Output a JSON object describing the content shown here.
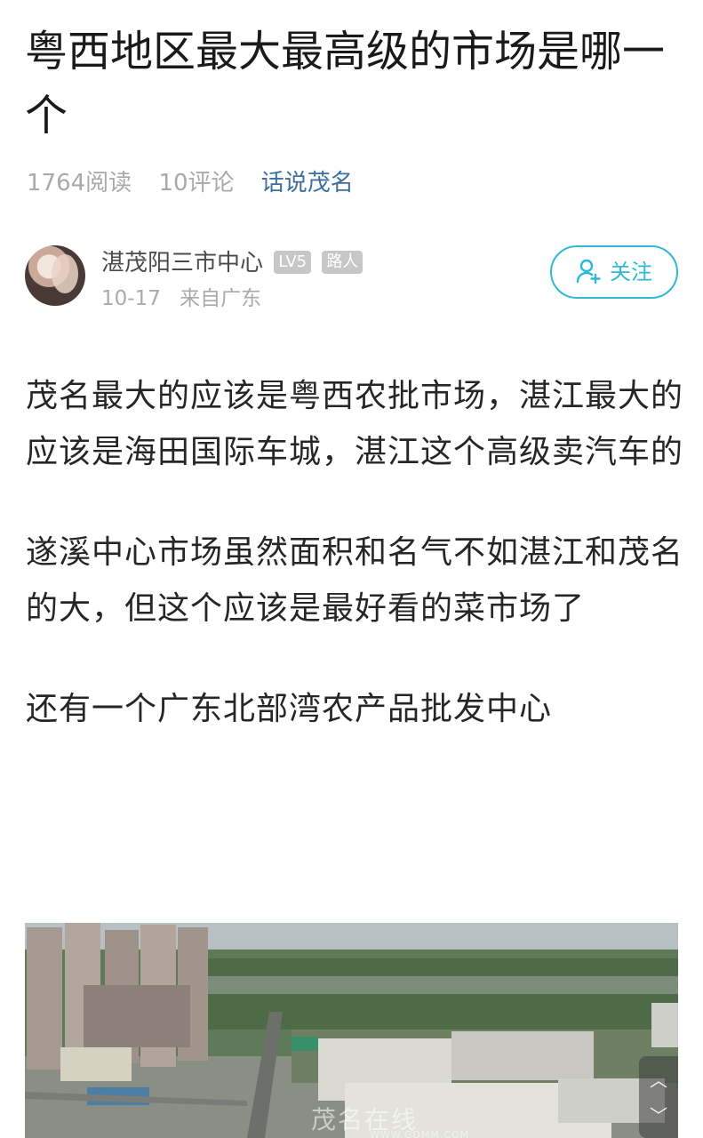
{
  "post": {
    "title": "粤西地区最大最高级的市场是哪一个",
    "reads": "1764阅读",
    "comments": "10评论",
    "topic": "话说茂名"
  },
  "author": {
    "name": "湛茂阳三市中心",
    "level_badge": "LV5",
    "role_badge": "路人",
    "date": "10-17",
    "location": "来自广东",
    "follow_label": "关注",
    "follow_icon": "user-plus-icon"
  },
  "article": {
    "paragraphs": [
      "茂名最大的应该是粤西农批市场，湛江最大的应该是海田国际车城，湛江这个高级卖汽车的",
      "遂溪中心市场虽然面积和名气不如湛江和茂名的大，但这个应该是最好看的菜市场了",
      "还有一个广东北部湾农产品批发中心"
    ]
  },
  "image": {
    "watermark": "茂名在线",
    "watermark_url": "WWW.GDMM.COM"
  },
  "colors": {
    "accent": "#2fb9d6",
    "topic": "#3c6f9e",
    "meta": "#a9a9a9",
    "badge": "#c7c7c7"
  }
}
